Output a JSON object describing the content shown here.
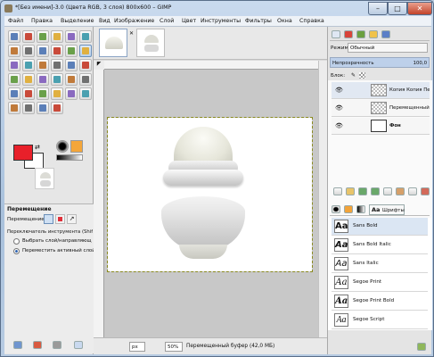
{
  "window": {
    "title": "*[Без имени]-3.0 (Цвета RGB, 3 слоя) 800x600 – GIMP",
    "min_label": "–",
    "max_label": "□",
    "close_label": "✕"
  },
  "menu": [
    "Файл",
    "Правка",
    "Выделение",
    "Вид",
    "Изображение",
    "Слой",
    "Цвет",
    "Инструменты",
    "Фильтры",
    "Окна",
    "Справка"
  ],
  "toolbox": {
    "tool_icons": [
      "rect-select",
      "ellipse-select",
      "free-select",
      "fuzzy-select",
      "select-by-color",
      "scissors-select",
      "foreground-select",
      "paths",
      "color-picker",
      "zoom",
      "measure",
      "move",
      "align",
      "crop",
      "rotate",
      "scale",
      "shear",
      "perspective",
      "flip",
      "cage-transform",
      "text",
      "bucket-fill",
      "blend",
      "pencil",
      "paintbrush",
      "eraser",
      "airbrush",
      "ink",
      "clone",
      "heal",
      "perspective-clone",
      "blur",
      "smudge",
      "dodge-burn"
    ],
    "foreground_color": "#e8202a",
    "background_color": "#ffffff",
    "options_title": "Перемещение",
    "move_label": "Перемещение:",
    "toggle_label": "Переключатель инструмента  (Shift",
    "radio_1": "Выбрать слой/направляющ",
    "radio_2": "Переместить активный слой"
  },
  "statusbar": {
    "unit": "px",
    "zoom": "50%",
    "message": "Перемещенный буфер (42,0 МБ)"
  },
  "layers": {
    "mode_label": "Режим:",
    "mode_value": "Обычный",
    "opacity_label": "Непрозрачность",
    "opacity_value": "100,0",
    "lock_label": "Блок:",
    "items": [
      {
        "name": "Копия Копия Пе"
      },
      {
        "name": "Перемещенный"
      },
      {
        "name": "Фон"
      }
    ]
  },
  "fonts": {
    "tab_label": "Шрифты",
    "sample": "Aa",
    "items": [
      {
        "name": "Sans Bold"
      },
      {
        "name": "Sans Bold Italic"
      },
      {
        "name": "Sans Italic"
      },
      {
        "name": "Segoe Print"
      },
      {
        "name": "Segoe Print Bold"
      },
      {
        "name": "Segoe Script"
      }
    ]
  }
}
